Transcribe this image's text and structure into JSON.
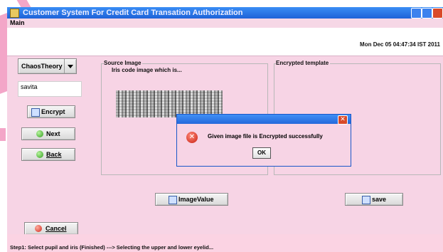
{
  "window": {
    "title": "Customer System For Credit Card Transation Authorization"
  },
  "menu": {
    "main": "Main"
  },
  "header": {
    "datetime": "Mon Dec 05 04:47:34 IST 2011"
  },
  "left": {
    "algorithm_selected": "ChaosTheory",
    "name_value": "savita",
    "encrypt_label": "Encrypt",
    "next_label": "Next",
    "back_label": "Back",
    "cancel_label": "Cancel"
  },
  "source": {
    "title": "Source Image",
    "caption": "Iris code image which is..."
  },
  "encrypted": {
    "title": "Encrypted template"
  },
  "actions": {
    "imagevalue_label": "ImageValue",
    "save_label": "save"
  },
  "dialog": {
    "message": "Given image file is Encrypted successfully",
    "ok_label": "OK",
    "close_glyph": "✕",
    "error_glyph": "✕"
  },
  "status": {
    "text": "Step1: Select pupil and iris (Finished) ---> Selecting the upper and lower eyelid..."
  },
  "colors": {
    "panel_bg": "#f7d4e5",
    "title_bar": "#1e62d8",
    "error_red": "#c81e10"
  }
}
